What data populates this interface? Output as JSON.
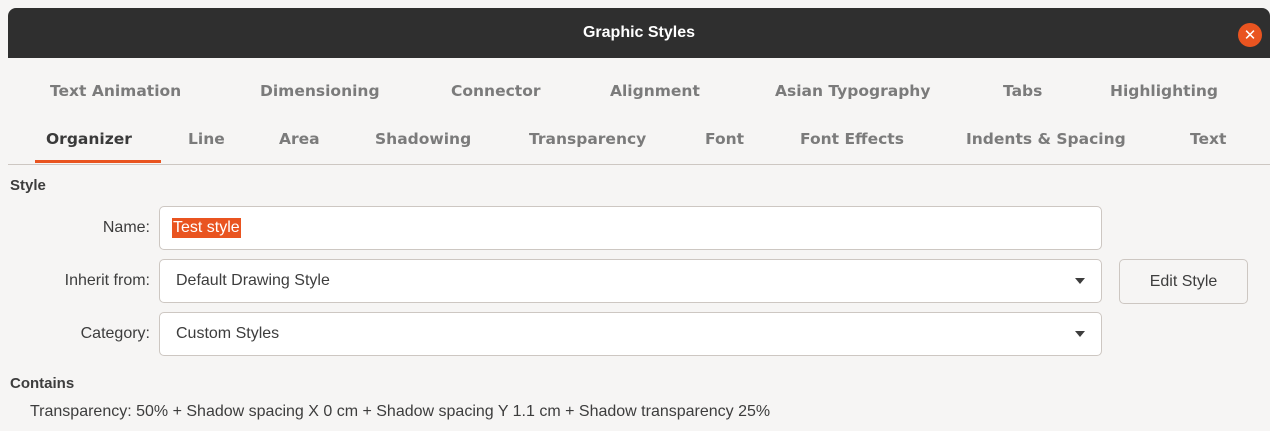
{
  "window": {
    "title": "Graphic Styles",
    "close_icon": "close-icon"
  },
  "tabs_row1": [
    "Text Animation",
    "Dimensioning",
    "Connector",
    "Alignment",
    "Asian Typography",
    "Tabs",
    "Highlighting"
  ],
  "tabs_row2": [
    "Organizer",
    "Line",
    "Area",
    "Shadowing",
    "Transparency",
    "Font",
    "Font Effects",
    "Indents & Spacing",
    "Text"
  ],
  "active_tab": "Organizer",
  "style": {
    "section_title": "Style",
    "name_label": "Name:",
    "name_value": "Test style",
    "inherit_label": "Inherit from:",
    "inherit_value": "Default Drawing Style",
    "category_label": "Category:",
    "category_value": "Custom Styles",
    "edit_button": "Edit Style"
  },
  "contains": {
    "section_title": "Contains",
    "text": "Transparency: 50% + Shadow spacing X 0 cm + Shadow spacing Y 1.1 cm + Shadow transparency 25%"
  },
  "colors": {
    "accent": "#e95420",
    "titlebar": "#2f2f2f"
  }
}
